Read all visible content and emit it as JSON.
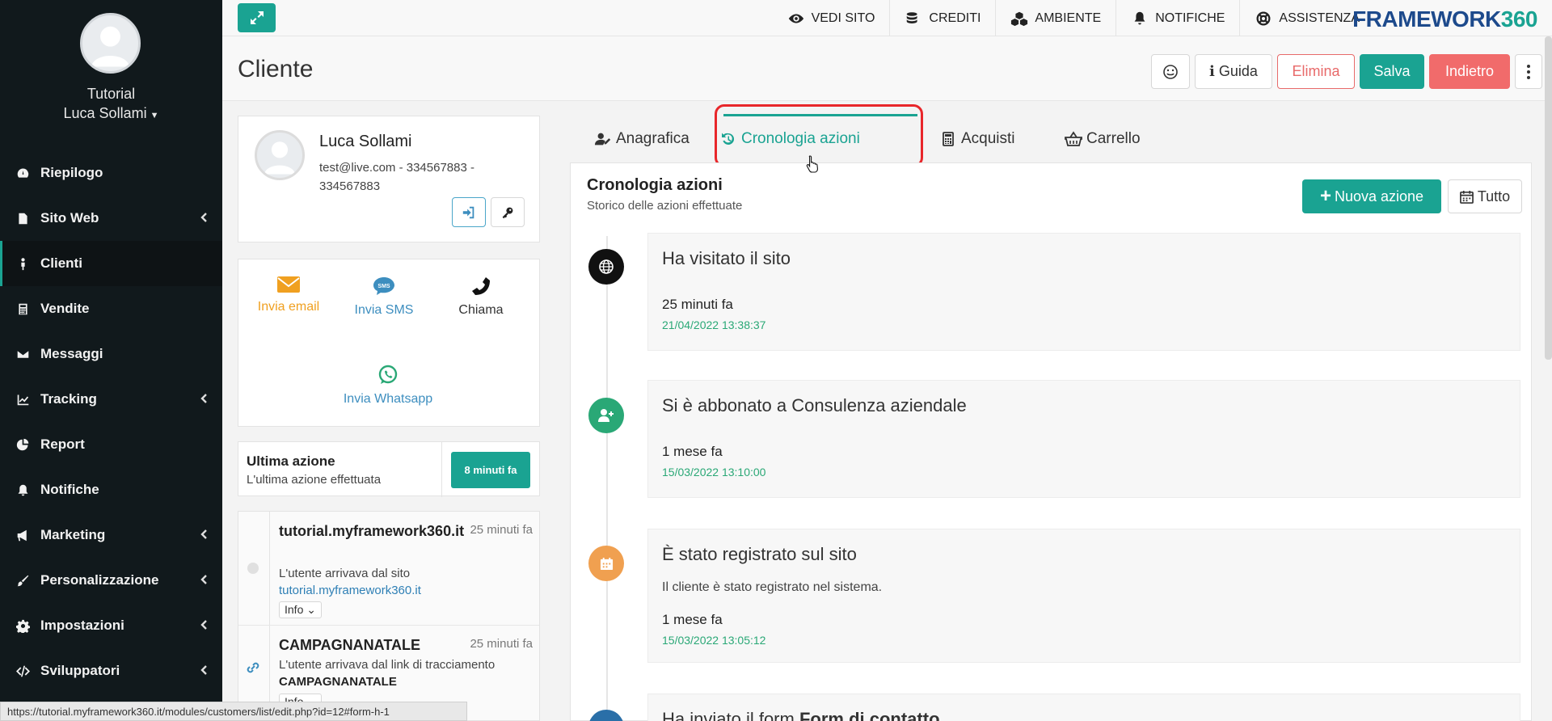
{
  "sidebar": {
    "role": "Tutorial",
    "user": "Luca Sollami",
    "items": [
      {
        "label": "Riepilogo",
        "icon": "dashboard-icon"
      },
      {
        "label": "Sito Web",
        "icon": "file-icon"
      },
      {
        "label": "Clienti",
        "icon": "person-icon"
      },
      {
        "label": "Vendite",
        "icon": "calculator-icon"
      },
      {
        "label": "Messaggi",
        "icon": "envelope-icon"
      },
      {
        "label": "Tracking",
        "icon": "line-chart-icon"
      },
      {
        "label": "Report",
        "icon": "pie-chart-icon"
      },
      {
        "label": "Notifiche",
        "icon": "bell-icon"
      },
      {
        "label": "Marketing",
        "icon": "megaphone-icon"
      },
      {
        "label": "Personalizzazione",
        "icon": "brush-icon"
      },
      {
        "label": "Impostazioni",
        "icon": "gear-icon"
      },
      {
        "label": "Sviluppatori",
        "icon": "code-icon"
      }
    ]
  },
  "topbar": {
    "vedi_sito": "VEDI SITO",
    "crediti": "CREDITI",
    "ambiente": "AMBIENTE",
    "notifiche": "NOTIFICHE",
    "assistenza": "ASSISTENZA",
    "brand_text": "FRAMEWORK",
    "brand_num": "360"
  },
  "header": {
    "title": "Cliente",
    "guida": "Guida",
    "elimina": "Elimina",
    "salva": "Salva",
    "indietro": "Indietro"
  },
  "profile": {
    "name": "Luca Sollami",
    "contact": "test@live.com - 334567883 - 334567883"
  },
  "contacts": {
    "email": "Invia email",
    "sms": "Invia SMS",
    "sms_badge": "SMS",
    "call": "Chiama",
    "whatsapp": "Invia Whatsapp"
  },
  "last_action": {
    "title": "Ultima azione",
    "subtitle": "L'ultima azione effettuata",
    "badge": "8 minuti fa"
  },
  "history": [
    {
      "title": "tutorial.myframework360.it",
      "time": "25 minuti fa",
      "desc": "L'utente arrivava dal sito",
      "link": "tutorial.myframework360.it",
      "info": "Info"
    },
    {
      "title": "CAMPAGNANATALE",
      "time": "25 minuti fa",
      "desc": "L'utente arrivava dal link di tracciamento",
      "link": "CAMPAGNANATALE",
      "info": "Info"
    }
  ],
  "tabs": [
    {
      "label": "Anagrafica"
    },
    {
      "label": "Cronologia azioni"
    },
    {
      "label": "Acquisti"
    },
    {
      "label": "Carrello"
    }
  ],
  "main": {
    "title": "Cronologia azioni",
    "subtitle": "Storico delle azioni effettuate",
    "new_action": "Nuova azione",
    "all": "Tutto",
    "events": [
      {
        "title": "Ha visitato il sito",
        "desc": "",
        "when": "25 minuti fa",
        "date": "21/04/2022 13:38:37",
        "color": "#111111"
      },
      {
        "title": "Si è abbonato a Consulenza aziendale",
        "desc": "",
        "when": "1 mese fa",
        "date": "15/03/2022 13:10:00",
        "color": "#2aa876"
      },
      {
        "title": "È stato registrato sul sito",
        "desc": "Il cliente è stato registrato nel sistema.",
        "when": "1 mese fa",
        "date": "15/03/2022 13:05:12",
        "color": "#f0a050"
      },
      {
        "title": "Ha inviato il form",
        "title_bold": "Form di contatto",
        "color": "#2a6fa8"
      }
    ]
  },
  "statusbar": {
    "url": "https://tutorial.myframework360.it/modules/customers/list/edit.php?id=12#form-h-1"
  },
  "colors": {
    "accent": "#1aa392",
    "danger": "#f16b6b",
    "sidebar_bg": "#11191c",
    "highlight": "#e8262a"
  }
}
